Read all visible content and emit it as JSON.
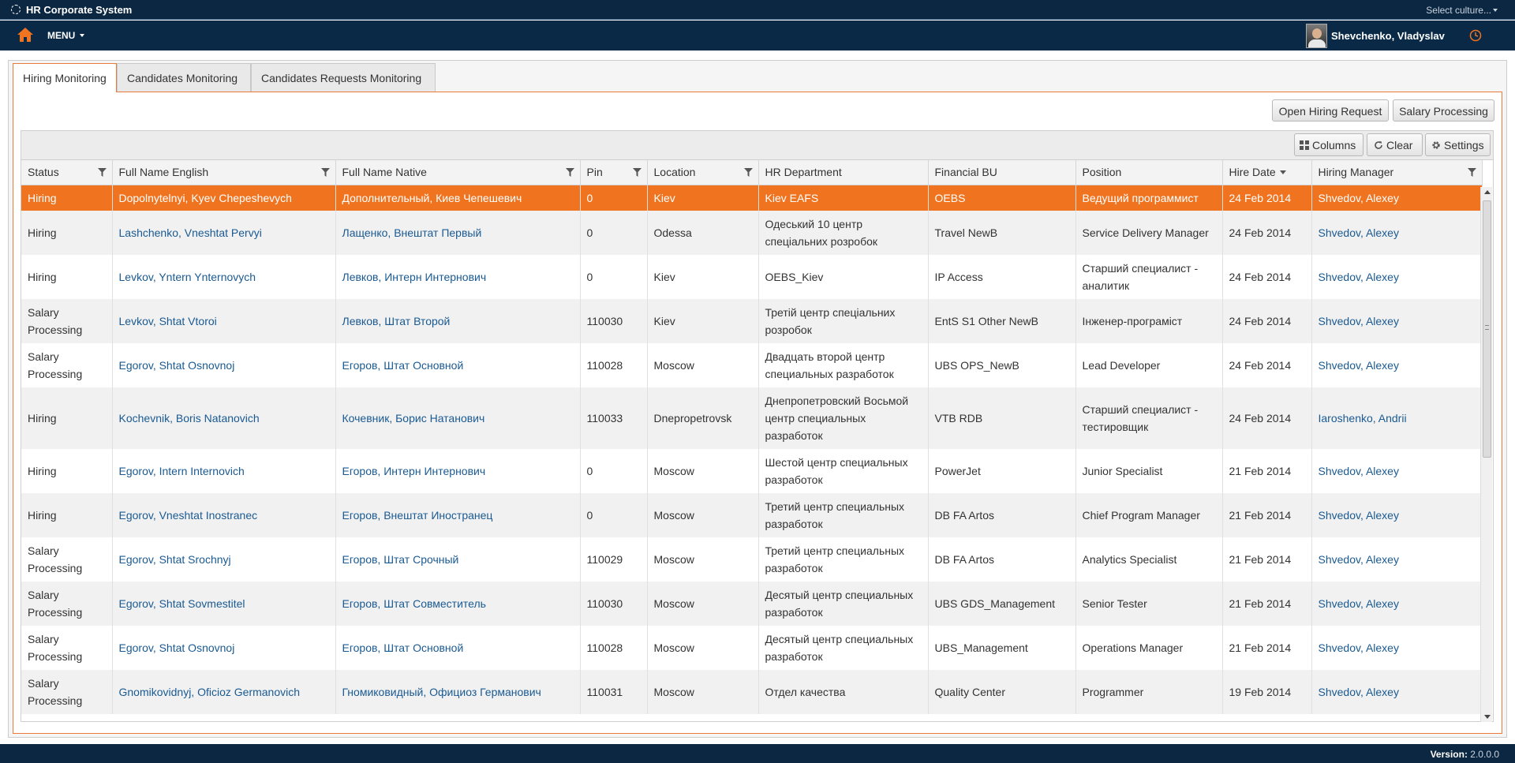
{
  "app": {
    "title": "HR Corporate System",
    "culture": "Select culture...",
    "menu_label": "MENU",
    "user_name": "Shevchenko, Vladyslav"
  },
  "tabs": [
    {
      "label": "Hiring Monitoring",
      "active": true
    },
    {
      "label": "Candidates Monitoring",
      "active": false
    },
    {
      "label": "Candidates Requests Monitoring",
      "active": false
    }
  ],
  "actions": {
    "open_hiring_request": "Open Hiring Request",
    "salary_processing": "Salary Processing"
  },
  "grid_toolbar": {
    "columns": "Columns",
    "clear": "Clear",
    "settings": "Settings"
  },
  "columns": [
    "Status",
    "Full Name English",
    "Full Name Native",
    "Pin",
    "Location",
    "HR Department",
    "Financial BU",
    "Position",
    "Hire Date",
    "Hiring Manager"
  ],
  "rows": [
    {
      "status": "Hiring",
      "name_en": "Dopolnytelnyi, Kyev Chepeshevych",
      "name_native": "Дополнительный, Киев Чепешевич",
      "pin": "0",
      "location": "Kiev",
      "hr_dept": "Kiev EAFS",
      "bu": "OEBS",
      "position": "Ведущий программист",
      "hire_date": "24 Feb 2014",
      "manager": "Shvedov, Alexey"
    },
    {
      "status": "Hiring",
      "name_en": "Lashchenko, Vneshtat Pervyi",
      "name_native": "Лащенко, Внештат Первый",
      "pin": "0",
      "location": "Odessa",
      "hr_dept": "Одеський 10 центр спеціальних розробок",
      "bu": "Travel NewB",
      "position": "Service Delivery Manager",
      "hire_date": "24 Feb 2014",
      "manager": "Shvedov, Alexey"
    },
    {
      "status": "Hiring",
      "name_en": "Levkov, Yntern Ynternovych",
      "name_native": "Левков, Интерн Интернович",
      "pin": "0",
      "location": "Kiev",
      "hr_dept": "OEBS_Kiev",
      "bu": "IP Access",
      "position": "Старший специалист - аналитик",
      "hire_date": "24 Feb 2014",
      "manager": "Shvedov, Alexey"
    },
    {
      "status": "Salary Processing",
      "name_en": "Levkov, Shtat Vtoroi",
      "name_native": "Левков, Штат Второй",
      "pin": "110030",
      "location": "Kiev",
      "hr_dept": "Третій центр спеціальних розробок",
      "bu": "EntS S1 Other NewB",
      "position": "Інженер-програміст",
      "hire_date": "24 Feb 2014",
      "manager": "Shvedov, Alexey"
    },
    {
      "status": "Salary Processing",
      "name_en": "Egorov, Shtat Osnovnoj",
      "name_native": "Егоров, Штат Основной",
      "pin": "110028",
      "location": "Moscow",
      "hr_dept": "Двадцать второй центр специальных разработок",
      "bu": "UBS OPS_NewB",
      "position": "Lead Developer",
      "hire_date": "24 Feb 2014",
      "manager": "Shvedov, Alexey"
    },
    {
      "status": "Hiring",
      "name_en": "Kochevnik, Boris Natanovich",
      "name_native": "Кочевник, Борис Натанович",
      "pin": "110033",
      "location": "Dnepropetrovsk",
      "hr_dept": "Днепропетровский Восьмой центр специальных разработок",
      "bu": "VTB RDB",
      "position": "Старший специалист - тестировщик",
      "hire_date": "24 Feb 2014",
      "manager": "Iaroshenko, Andrii"
    },
    {
      "status": "Hiring",
      "name_en": "Egorov, Intern Internovich",
      "name_native": "Егоров, Интерн Интернович",
      "pin": "0",
      "location": "Moscow",
      "hr_dept": "Шестой центр специальных разработок",
      "bu": "PowerJet",
      "position": "Junior Specialist",
      "hire_date": "21 Feb 2014",
      "manager": "Shvedov, Alexey"
    },
    {
      "status": "Hiring",
      "name_en": "Egorov, Vneshtat Inostranec",
      "name_native": "Егоров, Внештат Иностранец",
      "pin": "0",
      "location": "Moscow",
      "hr_dept": "Третий центр специальных разработок",
      "bu": "DB FA Artos",
      "position": "Chief Program Manager",
      "hire_date": "21 Feb 2014",
      "manager": "Shvedov, Alexey"
    },
    {
      "status": "Salary Processing",
      "name_en": "Egorov, Shtat Srochnyj",
      "name_native": "Егоров, Штат Срочный",
      "pin": "110029",
      "location": "Moscow",
      "hr_dept": "Третий центр специальных разработок",
      "bu": "DB FA Artos",
      "position": "Analytics Specialist",
      "hire_date": "21 Feb 2014",
      "manager": "Shvedov, Alexey"
    },
    {
      "status": "Salary Processing",
      "name_en": "Egorov, Shtat Sovmestitel",
      "name_native": "Егоров, Штат Совместитель",
      "pin": "110030",
      "location": "Moscow",
      "hr_dept": "Десятый центр специальных разработок",
      "bu": "UBS GDS_Management",
      "position": "Senior Tester",
      "hire_date": "21 Feb 2014",
      "manager": "Shvedov, Alexey"
    },
    {
      "status": "Salary Processing",
      "name_en": "Egorov, Shtat Osnovnoj",
      "name_native": "Егоров, Штат Основной",
      "pin": "110028",
      "location": "Moscow",
      "hr_dept": "Десятый центр специальных разработок",
      "bu": "UBS_Management",
      "position": "Operations Manager",
      "hire_date": "21 Feb 2014",
      "manager": "Shvedov, Alexey"
    },
    {
      "status": "Salary Processing",
      "name_en": "Gnomikovidnyj, Oficioz Germanovich",
      "name_native": "Гномиковидный, Официоз Германович",
      "pin": "110031",
      "location": "Moscow",
      "hr_dept": "Отдел качества",
      "bu": "Quality Center",
      "position": "Programmer",
      "hire_date": "19 Feb 2014",
      "manager": "Shvedov, Alexey"
    }
  ],
  "footer": {
    "version_label": "Version:",
    "version_value": "2.0.0.0"
  },
  "colors": {
    "accent": "#f07420",
    "header_bg": "#0a2946",
    "link": "#1a5a92"
  }
}
